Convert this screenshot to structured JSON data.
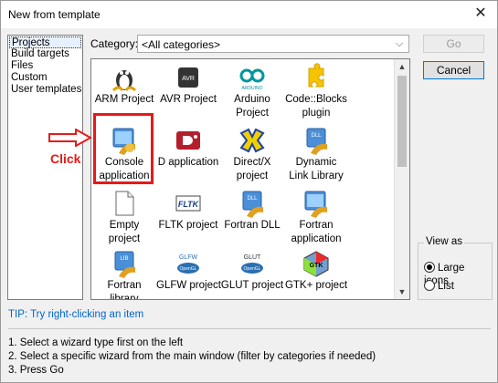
{
  "window": {
    "title": "New from template",
    "close_glyph": "✕"
  },
  "left_list": {
    "items": [
      {
        "label": "Projects",
        "selected": true
      },
      {
        "label": "Build targets",
        "selected": false
      },
      {
        "label": "Files",
        "selected": false
      },
      {
        "label": "Custom",
        "selected": false
      },
      {
        "label": "User templates",
        "selected": false
      }
    ]
  },
  "category": {
    "label": "Category:",
    "value": "<All categories>"
  },
  "items": [
    {
      "name": "arm-project-icon",
      "l1": "ARM Project",
      "l2": ""
    },
    {
      "name": "avr-project-icon",
      "l1": "AVR Project",
      "l2": ""
    },
    {
      "name": "arduino-project-icon",
      "l1": "Arduino",
      "l2": "Project"
    },
    {
      "name": "codeblocks-plugin-icon",
      "l1": "Code::Blocks",
      "l2": "plugin"
    },
    {
      "name": "console-application-icon",
      "l1": "Console",
      "l2": "application"
    },
    {
      "name": "d-application-icon",
      "l1": "D application",
      "l2": ""
    },
    {
      "name": "directx-project-icon",
      "l1": "Direct/X",
      "l2": "project"
    },
    {
      "name": "dynamic-link-library-icon",
      "l1": "Dynamic",
      "l2": "Link Library"
    },
    {
      "name": "empty-project-icon",
      "l1": "Empty",
      "l2": "project"
    },
    {
      "name": "fltk-project-icon",
      "l1": "FLTK project",
      "l2": ""
    },
    {
      "name": "fortran-dll-icon",
      "l1": "Fortran DLL",
      "l2": ""
    },
    {
      "name": "fortran-application-icon",
      "l1": "Fortran",
      "l2": "application"
    },
    {
      "name": "fortran-library-icon",
      "l1": "Fortran",
      "l2": "library"
    },
    {
      "name": "glfw-project-icon",
      "l1": "GLFW project",
      "l2": ""
    },
    {
      "name": "glut-project-icon",
      "l1": "GLUT project",
      "l2": ""
    },
    {
      "name": "gtk-project-icon",
      "l1": "GTK+ project",
      "l2": ""
    }
  ],
  "icon_text": {
    "avr": "AVR",
    "dll": "DLL",
    "fltk": "FLTK",
    "lib": "LIB",
    "glfw": "GLFW",
    "glut": "GLUT",
    "opengl": "OpenGL",
    "gtk": "GTK"
  },
  "annotation": {
    "click_text": "Click",
    "color": "#e81919"
  },
  "buttons": {
    "go": "Go",
    "cancel": "Cancel"
  },
  "view_as": {
    "legend": "View as",
    "large_icons": "Large icons",
    "list": "List",
    "selected": "large_icons"
  },
  "tip": "TIP: Try right-clicking an item",
  "instructions": [
    "1. Select a wizard type first on the left",
    "2. Select a specific wizard from the main window (filter by categories if needed)",
    "3. Press Go"
  ]
}
